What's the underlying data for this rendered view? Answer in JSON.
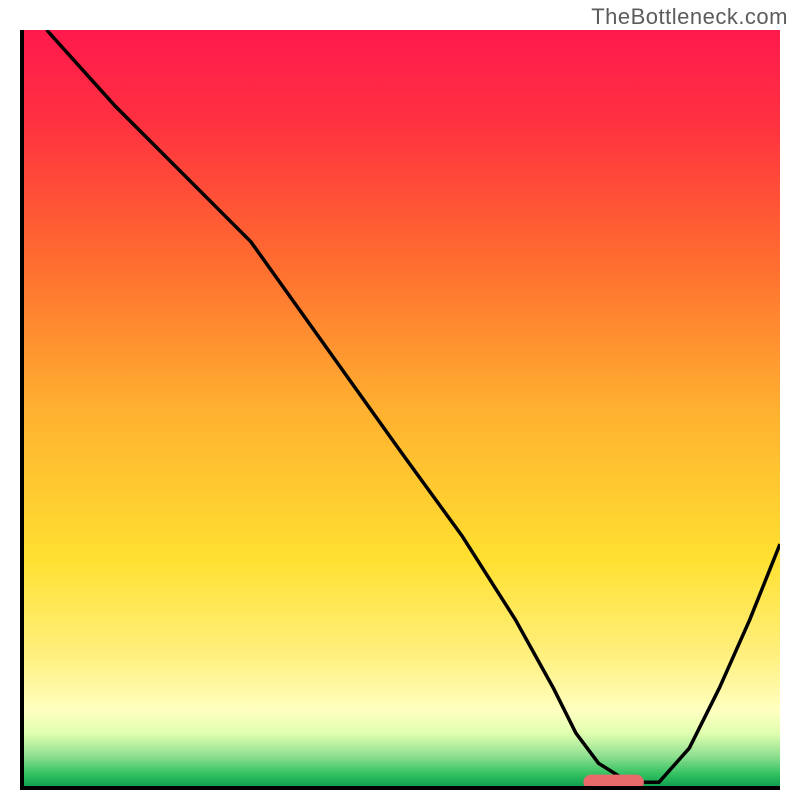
{
  "watermark": "TheBottleneck.com",
  "chart_data": {
    "type": "line",
    "title": "",
    "xlabel": "",
    "ylabel": "",
    "xlim": [
      0,
      100
    ],
    "ylim": [
      0,
      100
    ],
    "grid": false,
    "legend": false,
    "background_gradient": {
      "stops": [
        {
          "pos": 0.0,
          "color": "#ff1a4d"
        },
        {
          "pos": 0.12,
          "color": "#ff3040"
        },
        {
          "pos": 0.3,
          "color": "#ff6a30"
        },
        {
          "pos": 0.5,
          "color": "#ffb030"
        },
        {
          "pos": 0.7,
          "color": "#ffe030"
        },
        {
          "pos": 0.83,
          "color": "#fff080"
        },
        {
          "pos": 0.9,
          "color": "#ffffc0"
        },
        {
          "pos": 0.93,
          "color": "#e0ffb0"
        },
        {
          "pos": 0.96,
          "color": "#90e090"
        },
        {
          "pos": 0.985,
          "color": "#30c060"
        },
        {
          "pos": 1.0,
          "color": "#10a050"
        }
      ]
    },
    "series": [
      {
        "name": "bottleneck-curve",
        "color": "#000000",
        "width": 3.5,
        "x": [
          3,
          12,
          22,
          30,
          40,
          50,
          58,
          65,
          70,
          73,
          76,
          80,
          84,
          88,
          92,
          96,
          100
        ],
        "y": [
          100,
          90,
          80,
          72,
          58,
          44,
          33,
          22,
          13,
          7,
          3,
          0.5,
          0.5,
          5,
          13,
          22,
          32
        ]
      }
    ],
    "marker": {
      "name": "optimal-range-marker",
      "type": "capsule",
      "x_center": 78,
      "y": 0.5,
      "width": 8,
      "height": 2,
      "color": "#e86a6a"
    }
  }
}
